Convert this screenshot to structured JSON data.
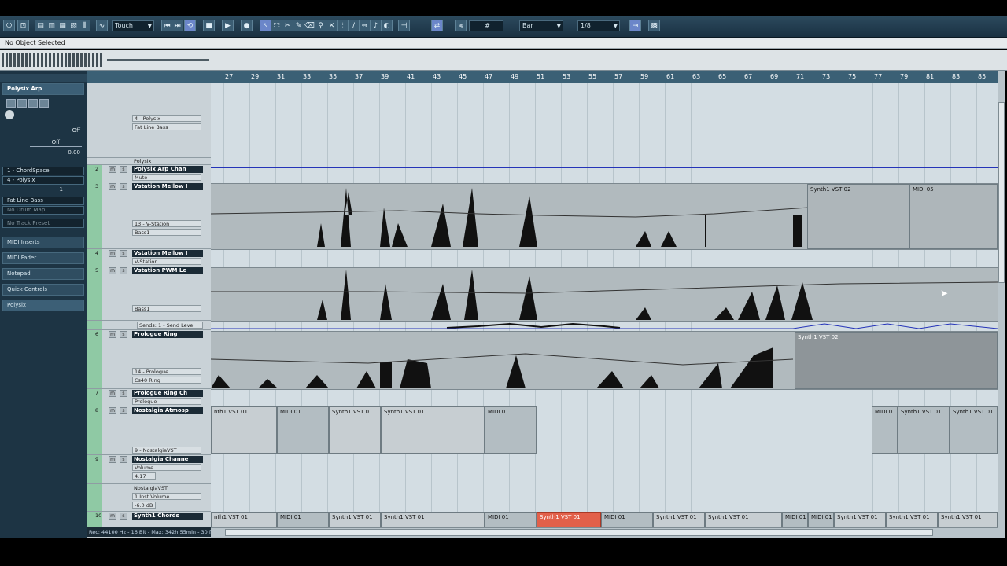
{
  "toolbar": {
    "automation_mode": "Touch",
    "snap_type": "Bar",
    "quantize": "1/8"
  },
  "info_line": "No Object Selected",
  "inspector": {
    "track_name": "Polysix Arp",
    "param_off1": "Off",
    "param_off2": "Off",
    "param_value": "0.00",
    "input_routing": "1 - ChordSpace",
    "output_routing": "4 - Polysix",
    "channel": "1",
    "program": "Fat Line Bass",
    "drum_map": "No Drum Map",
    "track_preset": "No Track Preset",
    "sections": [
      "MIDI Inserts",
      "MIDI Fader",
      "Notepad",
      "Quick Controls",
      "Polysix"
    ]
  },
  "ruler": {
    "bars": [
      "27",
      "29",
      "31",
      "33",
      "35",
      "37",
      "39",
      "41",
      "43",
      "45",
      "47",
      "49",
      "51",
      "53",
      "55",
      "57",
      "59",
      "61",
      "63",
      "65",
      "67",
      "69",
      "71",
      "73",
      "75",
      "77",
      "79",
      "81",
      "83",
      "85"
    ]
  },
  "tracks": [
    {
      "num": "",
      "name": "",
      "subs": [
        "4 - Polysix",
        "Fat Line Bass"
      ],
      "chan": "1"
    },
    {
      "num": "",
      "name": "Polysix",
      "subs": [],
      "chan": ""
    },
    {
      "num": "2",
      "name": "Polysix Arp Chan",
      "subs": [
        "Mute"
      ],
      "chan": ""
    },
    {
      "num": "3",
      "name": "Vstation Mellow I",
      "subs": [
        "13 - V-Station",
        "Bass1"
      ],
      "chan": "2"
    },
    {
      "num": "4",
      "name": "Vstation Mellow I",
      "subs": [
        "V-Station"
      ],
      "chan": ""
    },
    {
      "num": "5",
      "name": "Vstation PWM Le",
      "subs": [
        "Bass1"
      ],
      "chan": ""
    },
    {
      "num": "",
      "name": "Sends: 1 - Send Level",
      "subs": [],
      "chan": ""
    },
    {
      "num": "6",
      "name": "Prologue Ring",
      "subs": [
        "14 - Prologue",
        "Cs40 Ring"
      ],
      "chan": "3"
    },
    {
      "num": "7",
      "name": "Prologue Ring Ch",
      "subs": [
        "Prologue"
      ],
      "chan": ""
    },
    {
      "num": "8",
      "name": "Nostalgia Atmosp",
      "subs": [
        "9 - NostalgiaVST"
      ],
      "chan": "1"
    },
    {
      "num": "9",
      "name": "Nostalgia Channe",
      "subs": [
        "Volume",
        "4.17"
      ],
      "chan": ""
    },
    {
      "num": "",
      "name": "NostalgiaVST",
      "subs": [
        "1 Inst Volume",
        "-6.0 dB"
      ],
      "chan": ""
    },
    {
      "num": "10",
      "name": "Synth1 Chords",
      "subs": [],
      "chan": ""
    }
  ],
  "parts": {
    "row3": [
      "Synth1 VST 02",
      "MIDI 05"
    ],
    "row6": [
      "Synth1 VST 02"
    ],
    "row8": [
      "nth1 VST 01",
      "MIDI 01",
      "Synth1 VST 01",
      "Synth1 VST 01",
      "MIDI 01",
      "MIDI 01",
      "Synth1 VST 01",
      "Synth1 VST 01"
    ],
    "row10": [
      "nth1 VST 01",
      "MIDI 01",
      "Synth1 VST 01",
      "Synth1 VST 01",
      "MIDI 01",
      "Synth1 VST 01",
      "MIDI 01",
      "Synth1 VST 01",
      "Synth1 VST 01",
      "MIDI 01",
      "MIDI 01",
      "Synth1 VST 01",
      "Synth1 VST 01",
      "Synth1 VST 01"
    ]
  },
  "status_bar": "Rec: 44100 Hz - 16 Bit - Max: 342h 55min - 30 f",
  "colors": {
    "selected_part": "#e2604a",
    "track_number": "#8fc9a4",
    "ruler": "#3b6075",
    "toolbar": "#24404f"
  }
}
